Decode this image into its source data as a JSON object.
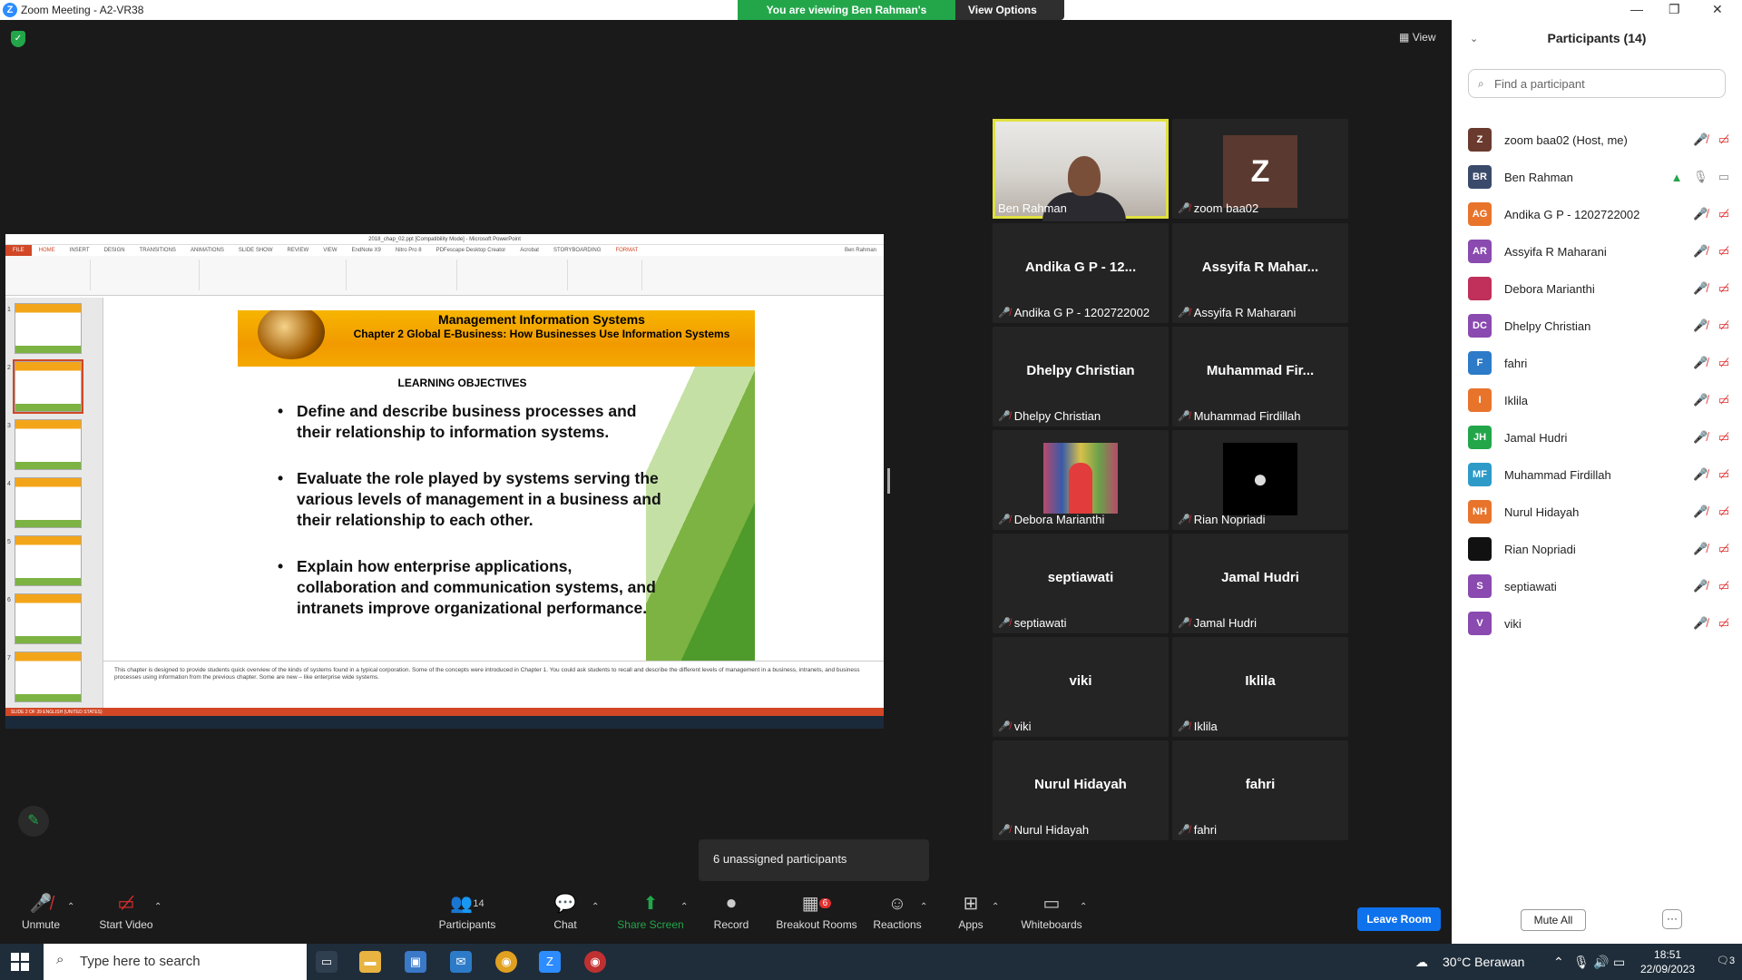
{
  "window": {
    "title": "Zoom Meeting - A2-VR38",
    "min": "—",
    "max": "❐",
    "close": "✕"
  },
  "banner": {
    "message": "You are viewing Ben Rahman's screen",
    "options": "View Options"
  },
  "view_label": "View",
  "powerpoint": {
    "title": "2018_chap_02.ppt [Compatibility Mode] - Microsoft PowerPoint",
    "tabs": [
      "FILE",
      "HOME",
      "INSERT",
      "DESIGN",
      "TRANSITIONS",
      "ANIMATIONS",
      "SLIDE SHOW",
      "REVIEW",
      "VIEW",
      "EndNote X9",
      "Nitro Pro 8",
      "PDFescape Desktop Creator",
      "Acrobat",
      "STORYBOARDING",
      "FORMAT"
    ],
    "user": "Ben Rahman",
    "slide_header_1": "Management Information Systems",
    "slide_header_2": "Chapter 2 Global E-Business: How Businesses Use Information Systems",
    "learning_objectives": "LEARNING OBJECTIVES",
    "bullets": [
      "Define and describe business processes and their relationship to information systems.",
      "Evaluate the role played by systems serving the various levels of management in a business and their relationship to each other.",
      "Explain how enterprise applications, collaboration and communication systems, and intranets improve organizational performance."
    ],
    "notes": "This chapter is designed to provide students quick overview of the kinds of systems found in a typical corporation.  Some of the concepts were introduced in Chapter 1. You could ask students to recall and describe the different levels of management in a business, intranets, and business processes using information from the previous chapter.  Some are new – like enterprise wide systems.",
    "status": "SLIDE 2 OF 39     ENGLISH (UNITED STATES)",
    "thumb_numbers": [
      "1",
      "2",
      "3",
      "4",
      "5",
      "6",
      "7"
    ]
  },
  "tiles": [
    {
      "label": "Ben Rahman",
      "big": ""
    },
    {
      "label": "zoom baa02",
      "big": "Z"
    },
    {
      "label": "Andika G P - 1202722002",
      "big": "Andika G P - 12..."
    },
    {
      "label": "Assyifa R Maharani",
      "big": "Assyifa R Mahar..."
    },
    {
      "label": "Dhelpy Christian",
      "big": "Dhelpy Christian"
    },
    {
      "label": "Muhammad Firdillah",
      "big": "Muhammad  Fir..."
    },
    {
      "label": "Debora Marianthi",
      "big": ""
    },
    {
      "label": "Rian Nopriadi",
      "big": ""
    },
    {
      "label": "septiawati",
      "big": "septiawati"
    },
    {
      "label": "Jamal Hudri",
      "big": "Jamal Hudri"
    },
    {
      "label": "viki",
      "big": "viki"
    },
    {
      "label": "Iklila",
      "big": "Iklila"
    },
    {
      "label": "Nurul Hidayah",
      "big": "Nurul Hidayah"
    },
    {
      "label": "fahri",
      "big": "fahri"
    }
  ],
  "unassigned": "6 unassigned participants",
  "toolbar": {
    "unmute": "Unmute",
    "start_video": "Start Video",
    "participants": "Participants",
    "participants_count": "14",
    "chat": "Chat",
    "share_screen": "Share Screen",
    "record": "Record",
    "breakout": "Breakout Rooms",
    "breakout_badge": "6",
    "reactions": "Reactions",
    "apps": "Apps",
    "whiteboards": "Whiteboards",
    "leave": "Leave Room"
  },
  "panel": {
    "title": "Participants (14)",
    "search_placeholder": "Find a participant",
    "participants": [
      {
        "initials": "Z",
        "name": "zoom baa02 (Host, me)",
        "color": "#6b3a2e"
      },
      {
        "initials": "BR",
        "name": "Ben Rahman",
        "color": "#3a4a6a"
      },
      {
        "initials": "AG",
        "name": "Andika G P - 1202722002",
        "color": "#e8742c"
      },
      {
        "initials": "AR",
        "name": "Assyifa R Maharani",
        "color": "#8a4ab0"
      },
      {
        "initials": "",
        "name": "Debora Marianthi",
        "color": "#c0305a"
      },
      {
        "initials": "DC",
        "name": "Dhelpy Christian",
        "color": "#8a4ab0"
      },
      {
        "initials": "F",
        "name": "fahri",
        "color": "#2d7bc8"
      },
      {
        "initials": "I",
        "name": "Iklila",
        "color": "#e8742c"
      },
      {
        "initials": "JH",
        "name": "Jamal Hudri",
        "color": "#23a64a"
      },
      {
        "initials": "MF",
        "name": "Muhammad Firdillah",
        "color": "#2d9ac8"
      },
      {
        "initials": "NH",
        "name": "Nurul Hidayah",
        "color": "#e8742c"
      },
      {
        "initials": "",
        "name": "Rian Nopriadi",
        "color": "#111111"
      },
      {
        "initials": "S",
        "name": "septiawati",
        "color": "#8a4ab0"
      },
      {
        "initials": "V",
        "name": "viki",
        "color": "#8a4ab0"
      }
    ],
    "mute_all": "Mute All",
    "more": "···"
  },
  "taskbar": {
    "search": "Type here to search",
    "weather": "30°C  Berawan",
    "time": "18:51",
    "date": "22/09/2023",
    "notif": "3"
  }
}
